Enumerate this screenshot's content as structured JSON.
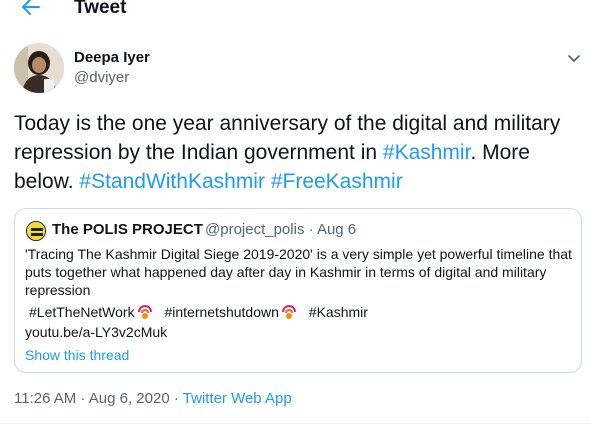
{
  "header": {
    "title": "Tweet",
    "back_icon": "arrow-left-icon"
  },
  "author": {
    "name": "Deepa Iyer",
    "handle": "@dviyer"
  },
  "tweet": {
    "text_plain_1": "Today is the one year anniversary of the digital and military repression by the Indian government in ",
    "tag_kashmir": "#Kashmir",
    "text_plain_2": ". More below. ",
    "tag_stand": "#StandWithKashmir",
    "text_plain_3": " ",
    "tag_free": "#FreeKashmir"
  },
  "quote": {
    "name": "The POLIS PROJECT",
    "meta": "@project_polis · Aug 6",
    "text": "'Tracing The Kashmir Digital Siege 2019-2020' is a very simple yet powerful timeline that puts together what happened day after day in Kashmir in terms of digital and military repression",
    "tag1": "#LetTheNetWork",
    "tag2": "#internetshutdown",
    "tag3": "#Kashmir",
    "url": "youtu.be/a-LY3v2cMuk",
    "show_thread": "Show this thread"
  },
  "footer": {
    "time": "11:26 AM · Aug 6, 2020 · ",
    "app": "Twitter Web App"
  },
  "colors": {
    "accent": "#1d9bf0",
    "muted": "#536471",
    "text": "#0f1419",
    "border": "#cfd9de"
  }
}
